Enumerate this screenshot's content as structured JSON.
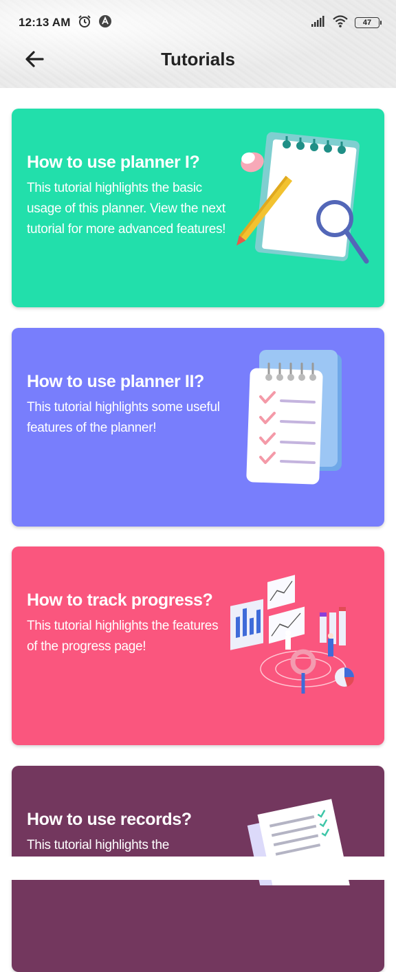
{
  "status_bar": {
    "time": "12:13 AM",
    "battery": "47"
  },
  "toolbar": {
    "title": "Tutorials"
  },
  "colors": {
    "card1": "#22DFAB",
    "card2": "#787EFC",
    "card3": "#FA567E",
    "card4": "#73375E"
  },
  "tutorials": [
    {
      "title": "How to use planner I?",
      "description": "This tutorial highlights the basic usage of this planner. View the next tutorial for more advanced features!",
      "icon": "notepad-pencil-magnifier-illustration"
    },
    {
      "title": "How to use planner II?",
      "description": "This tutorial highlights some useful features of the planner!",
      "icon": "checklist-notepad-illustration"
    },
    {
      "title": "How to track progress?",
      "description": "This tutorial highlights the features of the progress page!",
      "icon": "analytics-dashboard-illustration"
    },
    {
      "title": "How to use records?",
      "description": "This tutorial highlights the",
      "icon": "document-records-illustration"
    }
  ]
}
